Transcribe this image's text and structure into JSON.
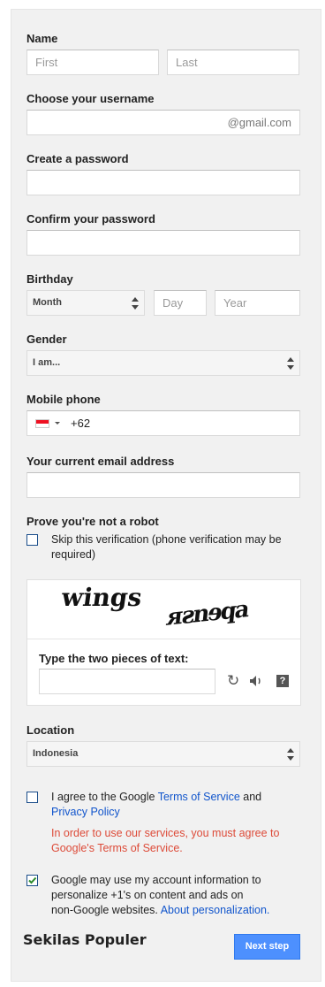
{
  "name": {
    "label": "Name",
    "first_placeholder": "First",
    "last_placeholder": "Last"
  },
  "username": {
    "label": "Choose your username",
    "suffix": "@gmail.com"
  },
  "password": {
    "label": "Create a password"
  },
  "confirm": {
    "label": "Confirm your password"
  },
  "birthday": {
    "label": "Birthday",
    "month": "Month",
    "day_placeholder": "Day",
    "year_placeholder": "Year"
  },
  "gender": {
    "label": "Gender",
    "value": "I am..."
  },
  "phone": {
    "label": "Mobile phone",
    "code": "+62"
  },
  "email": {
    "label": "Your current email address"
  },
  "robot": {
    "label": "Prove you're not a robot",
    "skip_line1": "Skip this verification (phone verification may be",
    "skip_line2": "required)",
    "captcha_word1": "wings",
    "captcha_word2": "ᴙƨnɘqa",
    "captcha_prompt": "Type the two pieces of text:"
  },
  "location": {
    "label": "Location",
    "value": "Indonesia"
  },
  "terms": {
    "line1_pre": "I agree to the Google ",
    "tos_link": "Terms of Service",
    "line1_post": " and",
    "privacy_link": "Privacy Policy",
    "error_line1": "In order to use our services, you must agree to",
    "error_line2": "Google's Terms of Service."
  },
  "personalize": {
    "line1": "Google may use my account information to",
    "line2": "personalize +1's on content and ads on",
    "line3_pre": "non-Google websites. ",
    "link": "About personalization."
  },
  "footer": {
    "brand": "Sekilas Populer",
    "next_button": "Next step"
  },
  "colors": {
    "panel": "#f1f1f1",
    "link": "#1155cc",
    "error": "#dd4b39",
    "button": "#4d90fe",
    "checkbox": "#1a4d8a"
  },
  "icons": {
    "refresh": "refresh-icon",
    "audio": "audio-icon",
    "help": "help-icon",
    "flag": "indonesia-flag-icon"
  }
}
